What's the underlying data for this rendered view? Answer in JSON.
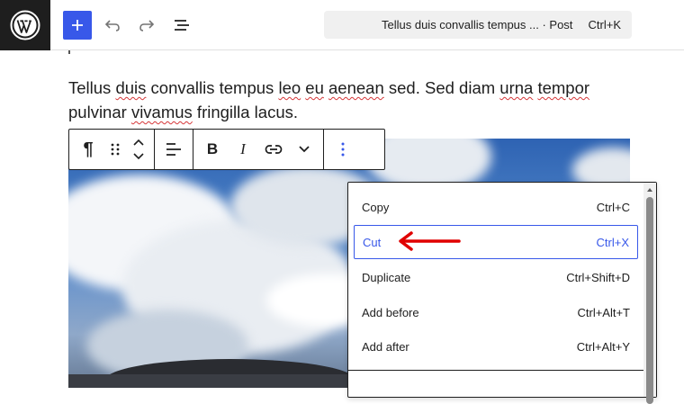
{
  "topbar": {
    "logo_icon": "wordpress-logo",
    "add_icon": "plus-icon",
    "undo_icon": "undo-icon",
    "redo_icon": "redo-icon",
    "outline_icon": "list-view-icon",
    "doc_title": "Tellus duis convallis tempus ... · Post",
    "doc_shortcut": "Ctrl+K",
    "accent_color": "#3858e9"
  },
  "content": {
    "paragraph_parts": [
      "Tellus ",
      "duis",
      " convallis tempus ",
      "leo",
      " ",
      "eu",
      " ",
      "aenean",
      " sed. Sed diam ",
      "urna",
      " ",
      "tempor",
      " pulvinar ",
      "vivamus",
      " fringilla lacus."
    ]
  },
  "block_toolbar": {
    "icons": [
      "paragraph-icon",
      "drag-handle-icon",
      "move-up-icon",
      "move-down-icon",
      "align-icon",
      "bold-icon",
      "italic-icon",
      "link-icon",
      "more-rich-text-icon",
      "options-icon"
    ],
    "bold_glyph": "B",
    "italic_glyph": "I",
    "paragraph_glyph": "¶"
  },
  "menu": {
    "items": [
      {
        "label": "Copy",
        "shortcut": "Ctrl+C"
      },
      {
        "label": "Cut",
        "shortcut": "Ctrl+X"
      },
      {
        "label": "Duplicate",
        "shortcut": "Ctrl+Shift+D"
      },
      {
        "label": "Add before",
        "shortcut": "Ctrl+Alt+T"
      },
      {
        "label": "Add after",
        "shortcut": "Ctrl+Alt+Y"
      }
    ],
    "focused_color": "#3858e9",
    "annotation_arrow_color": "#e00000"
  }
}
